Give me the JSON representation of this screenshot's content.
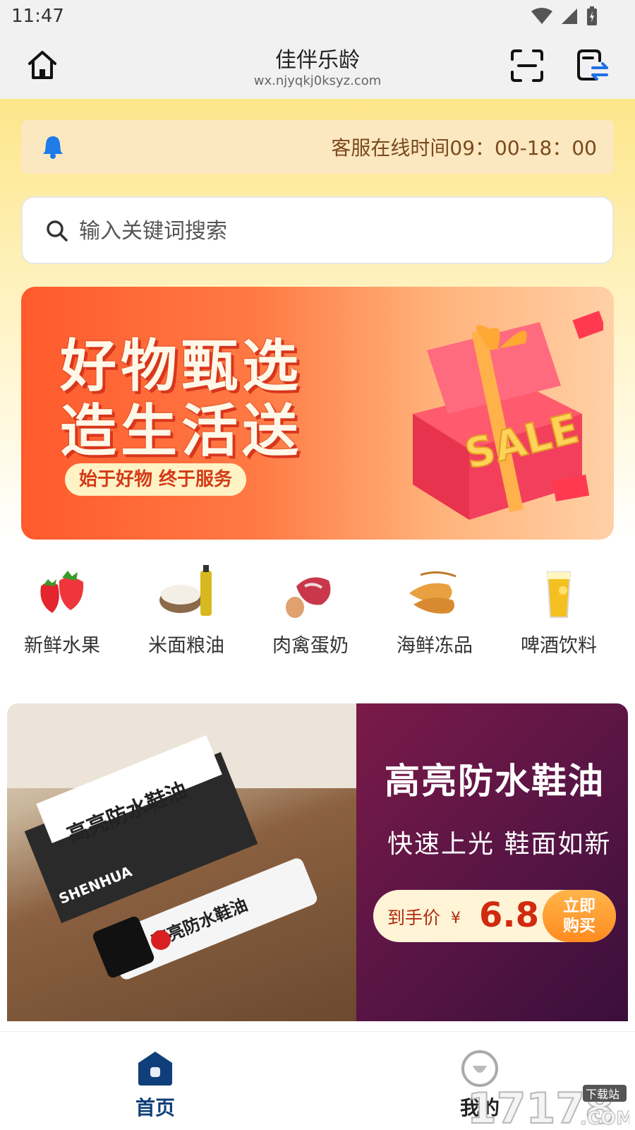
{
  "status_bar": {
    "time": "11:47"
  },
  "header": {
    "title": "佳伴乐龄",
    "url": "wx.njyqkj0ksyz.com",
    "home_icon": "home-icon",
    "scan_icon": "scan-icon",
    "switch_icon": "switch-icon"
  },
  "notice": {
    "text": "客服在线时间09：00-18：00",
    "icon": "bell-icon"
  },
  "search": {
    "placeholder": "输入关键词搜索",
    "icon": "search-icon"
  },
  "promo_banner": {
    "line1": "好物甄选",
    "line2": "造生活送",
    "tagline": "始于好物 终于服务",
    "box_label": "SALE"
  },
  "categories": [
    {
      "label": "新鲜水果",
      "icon": "strawberry-icon"
    },
    {
      "label": "米面粮油",
      "icon": "rice-oil-icon"
    },
    {
      "label": "肉禽蛋奶",
      "icon": "meat-egg-icon"
    },
    {
      "label": "海鲜冻品",
      "icon": "shrimp-icon"
    },
    {
      "label": "啤酒饮料",
      "icon": "drink-icon"
    }
  ],
  "product_banner": {
    "title": "高亮防水鞋油",
    "subtitle": "快速上光 鞋面如新",
    "price_label": "到手价",
    "currency": "¥",
    "price": "6.8",
    "buy_line1": "立即",
    "buy_line2": "购买",
    "product_text": "高亮防水鞋油",
    "brand": "SHENHUA"
  },
  "tabbar": {
    "items": [
      {
        "label": "首页",
        "active": true,
        "color": "#0f3f7a"
      },
      {
        "label": "我的",
        "active": false,
        "color": "#222222"
      }
    ]
  },
  "watermark": {
    "text": "17178",
    "sub": "下载站",
    "suffix": ".COM"
  },
  "colors": {
    "accent": "#0f3f7a",
    "notice_text": "#7a4a1e",
    "price": "#d12a10"
  }
}
